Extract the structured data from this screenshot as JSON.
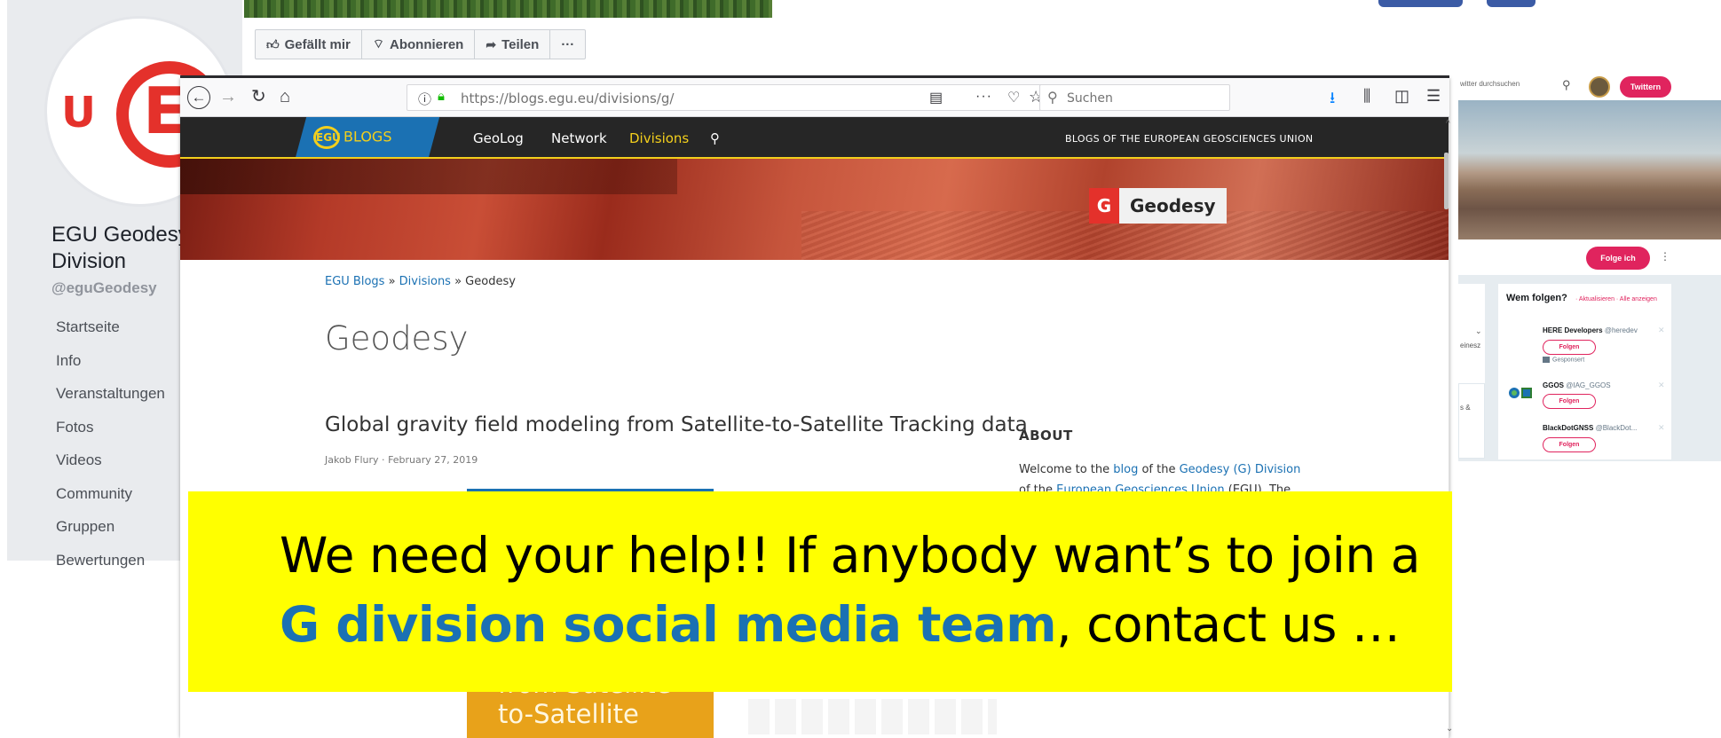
{
  "facebook": {
    "actions": [
      {
        "icon": "thumbs-up-icon",
        "label": "Gefällt mir"
      },
      {
        "icon": "rss-icon",
        "label": "Abonnieren"
      },
      {
        "icon": "share-arrow-icon",
        "label": "Teilen"
      },
      {
        "icon": "more-icon",
        "label": "···"
      }
    ],
    "page_name_line1": "EGU Geodesy",
    "page_name_line2": "Division",
    "handle": "@eguGeodesy",
    "nav": [
      "Startseite",
      "Info",
      "Veranstaltungen",
      "Fotos",
      "Videos",
      "Community",
      "Gruppen",
      "Bewertungen"
    ],
    "brand_color": "#e4312b"
  },
  "twitter": {
    "search_placeholder": "witter durchsuchen",
    "tweet_button": "Twittern",
    "follow_button": "Folge ich",
    "who_to_follow": "Wem folgen?",
    "who_to_follow_links": "· Aktualisieren · Alle anzeigen",
    "left_snippet_1": "einesz",
    "left_snippet_2": "s &",
    "suggestions": [
      {
        "name": "HERE Developers",
        "handle": "@heredev",
        "button": "Folgen"
      },
      {
        "name": "GGOS",
        "handle": "@IAG_GGOS",
        "button": "Folgen"
      },
      {
        "name": "BlackDotGNSS",
        "handle": "@BlackDot...",
        "button": "Folgen"
      }
    ],
    "sponsored": "Gesponsert",
    "accent_color": "#e0245e"
  },
  "browser": {
    "url": "https://blogs.egu.eu/divisions/g/",
    "search_placeholder": "Suchen",
    "site": {
      "logo_mark": "EGU",
      "logo_text": "BLOGS",
      "menu": [
        "GeoLog",
        "Network",
        "Divisions"
      ],
      "active_menu": "Divisions",
      "tagline": "BLOGS OF THE EUROPEAN GEOSCIENCES UNION",
      "badge_letter": "G",
      "badge_title": "Geodesy",
      "breadcrumb": [
        "EGU Blogs",
        "Divisions",
        "Geodesy"
      ],
      "breadcrumb_sep": " » ",
      "page_title": "Geodesy",
      "post_title": "Global gravity field modeling from Satellite-to-Satellite Tracking data",
      "post_author": "Jakob Flury",
      "post_date": "February 27, 2019",
      "book_lines": [
        "from Satellite-",
        "to-Satellite"
      ],
      "about_heading": "ABOUT",
      "about_text": {
        "p1": "Welcome to the ",
        "link1": "blog",
        "p2": " of the ",
        "link2": "Geodesy (G) Division",
        "p3": " of the ",
        "link3": "European Geosciences Union",
        "p4": " (EGU). The"
      }
    }
  },
  "callout": {
    "line1": "We need your help!! If anybody want’s to join a",
    "highlight": "G division social media team",
    "line2_rest": ", contact us …",
    "background": "#ffff00",
    "highlight_color": "#1b71b3"
  }
}
